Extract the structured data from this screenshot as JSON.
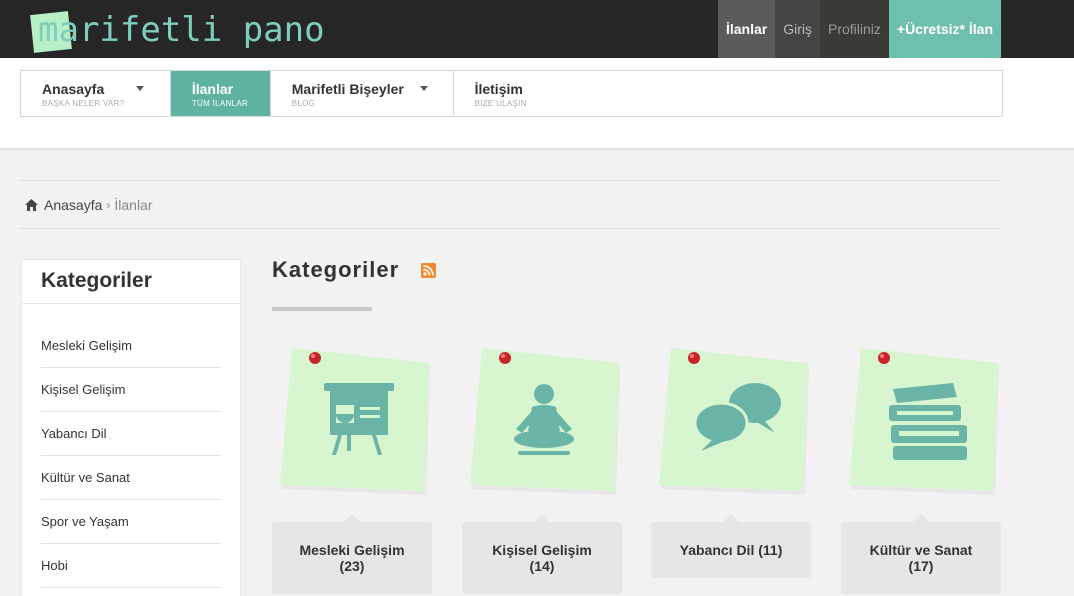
{
  "brand": {
    "logo_text": "marifetli pano"
  },
  "topnav": [
    {
      "label": "İlanlar"
    },
    {
      "label": "Giriş"
    },
    {
      "label": "Profiliniz"
    },
    {
      "label": "+Ücretsiz* İlan"
    }
  ],
  "menu": [
    {
      "title": "Anasayfa",
      "subtitle": "BAŞKA NELER VAR?",
      "has_dropdown": true
    },
    {
      "title": "İlanlar",
      "subtitle": "TÜM İLANLAR",
      "active": true
    },
    {
      "title": "Marifetli Bişeyler",
      "subtitle": "BLOG",
      "has_dropdown": true
    },
    {
      "title": "İletişim",
      "subtitle": "BİZE ULAŞIN"
    }
  ],
  "breadcrumb": {
    "home": "Anasayfa",
    "separator": "›",
    "current": "İlanlar"
  },
  "sidebar": {
    "title": "Kategoriler",
    "items": [
      "Mesleki Gelişim",
      "Kişisel Gelişim",
      "Yabancı Dil",
      "Kültür ve Sanat",
      "Spor ve Yaşam",
      "Hobi"
    ]
  },
  "content": {
    "heading": "Kategoriler",
    "rss_icon": "rss-icon",
    "categories": [
      {
        "name": "Mesleki Gelişim",
        "count": "(23)",
        "icon": "presentation-board-icon"
      },
      {
        "name": "Kişisel Gelişim",
        "count": "(14)",
        "icon": "meditation-icon"
      },
      {
        "name": "Yabancı Dil",
        "count": "(11)",
        "icon": "speech-bubbles-icon"
      },
      {
        "name": "Kültür ve Sanat",
        "count": "(17)",
        "icon": "books-icon"
      }
    ]
  },
  "colors": {
    "topbar": "#262626",
    "accent": "#5fb3a2",
    "note": "#d8f7d1",
    "icon": "#6bb4a8",
    "pin": "#c8242a"
  }
}
